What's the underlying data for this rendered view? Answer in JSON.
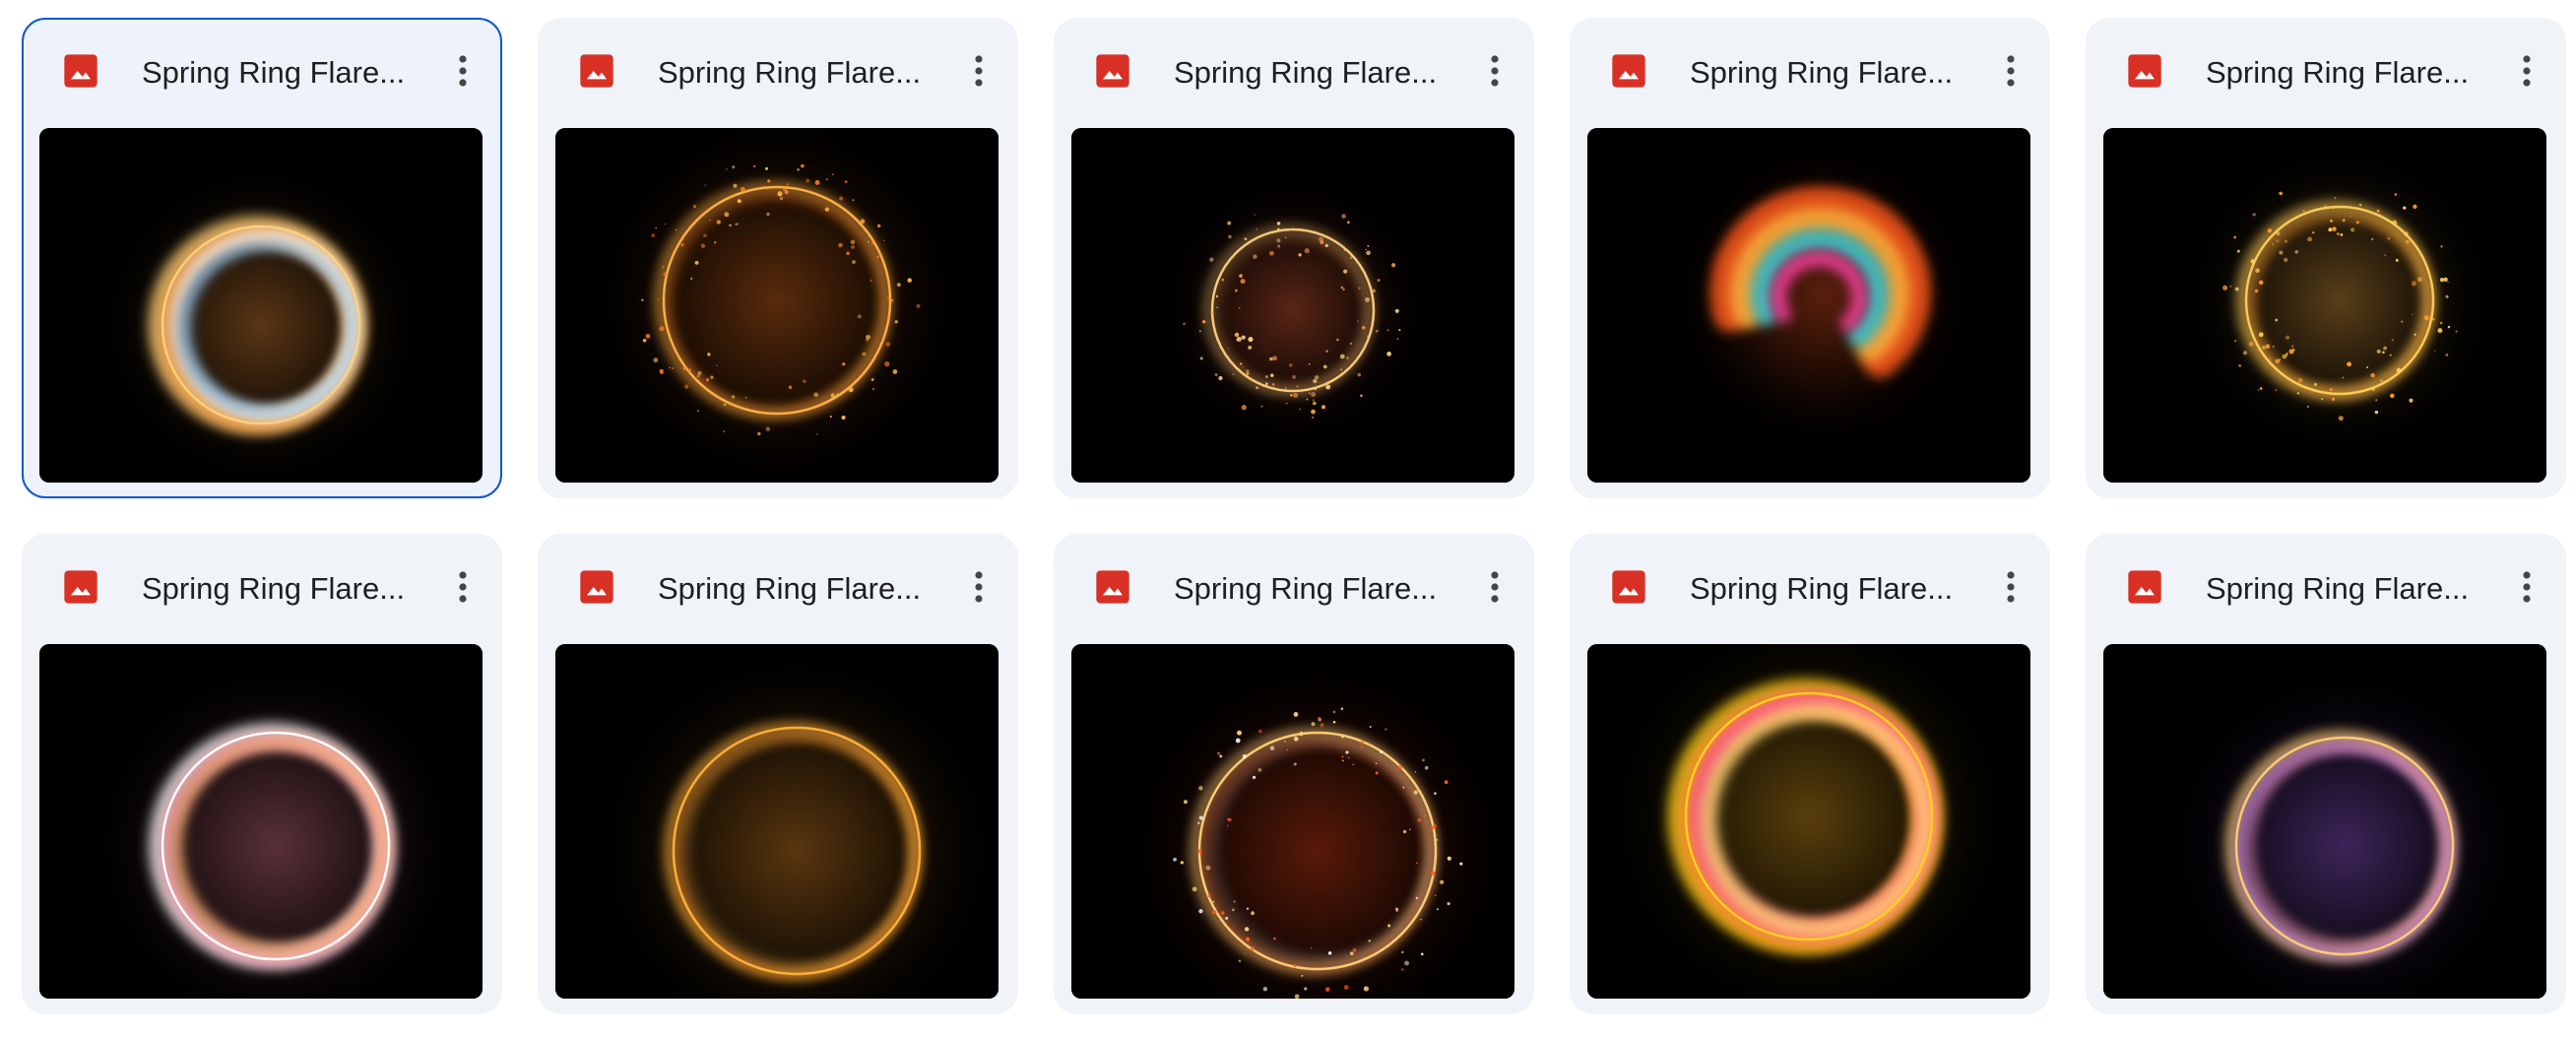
{
  "files": [
    {
      "title": "Spring Ring Flare...",
      "selected": true,
      "icon": "image-file-icon",
      "preview": "golden-swirl-ring"
    },
    {
      "title": "Spring Ring Flare...",
      "selected": false,
      "icon": "image-file-icon",
      "preview": "sparkle-orange-ring"
    },
    {
      "title": "Spring Ring Flare...",
      "selected": false,
      "icon": "image-file-icon",
      "preview": "small-sparkle-ring"
    },
    {
      "title": "Spring Ring Flare...",
      "selected": false,
      "icon": "image-file-icon",
      "preview": "fiery-spiral-swirl"
    },
    {
      "title": "Spring Ring Flare...",
      "selected": false,
      "icon": "image-file-icon",
      "preview": "golden-dust-ring"
    },
    {
      "title": "Spring Ring Flare...",
      "selected": false,
      "icon": "image-file-icon",
      "preview": "pink-white-swirl-ring"
    },
    {
      "title": "Spring Ring Flare...",
      "selected": false,
      "icon": "image-file-icon",
      "preview": "amber-thin-ring"
    },
    {
      "title": "Spring Ring Flare...",
      "selected": false,
      "icon": "image-file-icon",
      "preview": "red-orange-particle-ring"
    },
    {
      "title": "Spring Ring Flare...",
      "selected": false,
      "icon": "image-file-icon",
      "preview": "bright-yellow-ring"
    },
    {
      "title": "Spring Ring Flare...",
      "selected": false,
      "icon": "image-file-icon",
      "preview": "purple-gold-ring"
    }
  ],
  "colors": {
    "card_bg": "#f0f4f9",
    "selected_border": "#0b57d0",
    "image_icon": "#d93025",
    "text": "#1f1f1f",
    "more_icon": "#444746"
  }
}
